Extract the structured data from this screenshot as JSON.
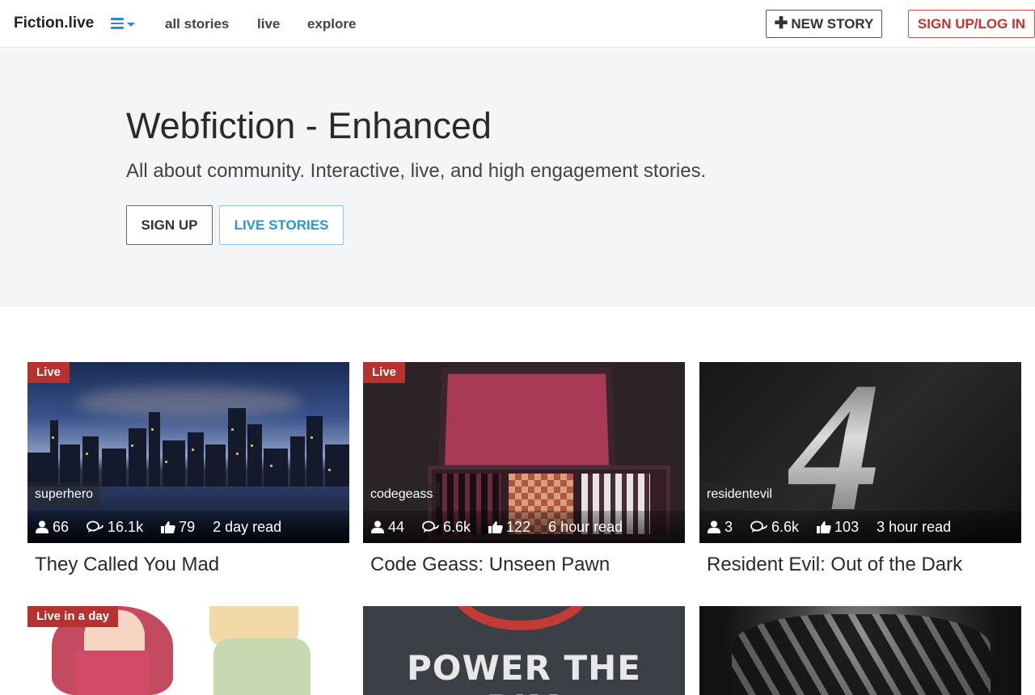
{
  "navbar": {
    "brand": "Fiction.live",
    "links": [
      "all stories",
      "live",
      "explore"
    ],
    "new_story_label": "NEW STORY",
    "login_label": "SIGN UP/LOG IN"
  },
  "hero": {
    "title": "Webfiction - Enhanced",
    "subtitle": "All about community. Interactive, live, and high engagement stories.",
    "signup_label": "SIGN UP",
    "live_label": "LIVE STORIES"
  },
  "cards": [
    {
      "badge": "Live",
      "tag": "superhero",
      "readers": "66",
      "comments": "16.1k",
      "likes": "79",
      "read_time": "2 day read",
      "title": "They Called You Mad"
    },
    {
      "badge": "Live",
      "tag": "codegeass",
      "readers": "44",
      "comments": "6.6k",
      "likes": "122",
      "read_time": "6 hour read",
      "title": "Code Geass: Unseen Pawn"
    },
    {
      "badge": "",
      "tag": "residentevil",
      "readers": "3",
      "comments": "6.6k",
      "likes": "103",
      "read_time": "3 hour read",
      "title": "Resident Evil: Out of the Dark"
    },
    {
      "badge": "Live in a day"
    },
    {
      "badge": "",
      "image_text": "POWER THE RIM"
    },
    {
      "badge": ""
    }
  ],
  "colors": {
    "accent": "#2a8bd5",
    "live_badge": "#b5322e",
    "login": "#c9302c",
    "hero_bg": "#f3f5f7"
  },
  "icons": {
    "readers": "user-icon",
    "comments": "comments-icon",
    "likes": "thumbs-up-icon",
    "menu": "menu-icon"
  }
}
